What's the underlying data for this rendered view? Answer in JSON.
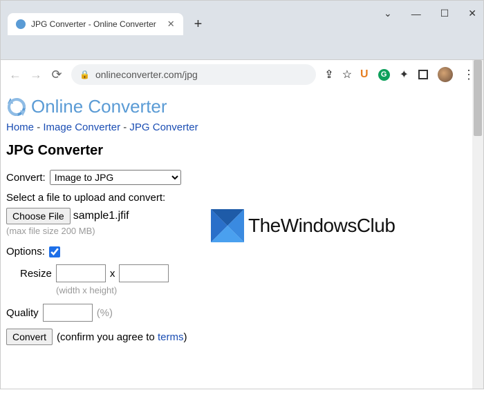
{
  "browser": {
    "tab_title": "JPG Converter - Online Converter",
    "url": "onlineconverter.com/jpg"
  },
  "site": {
    "title": "Online Converter"
  },
  "breadcrumb": {
    "home": "Home",
    "sep": "-",
    "image": "Image Converter",
    "jpg": "JPG Converter"
  },
  "page_title": "JPG Converter",
  "form": {
    "convert_label": "Convert:",
    "convert_selected": "Image to JPG",
    "upload_label": "Select a file to upload and convert:",
    "choose_file": "Choose File",
    "filename": "sample1.jfif",
    "max_size_hint": "(max file size 200 MB)",
    "options_label": "Options:",
    "resize_label": "Resize",
    "resize_sep": "x",
    "resize_hint": "(width x height)",
    "quality_label": "Quality",
    "quality_unit": "(%)",
    "convert_btn": "Convert",
    "confirm_prefix": "(confirm you agree to ",
    "terms": "terms",
    "confirm_suffix": ")"
  },
  "watermark": {
    "text": "TheWindowsClub"
  }
}
